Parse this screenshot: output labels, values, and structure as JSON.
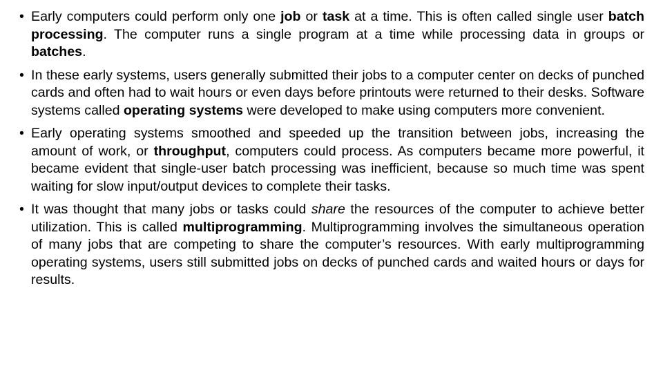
{
  "bullets": [
    {
      "segments": [
        {
          "t": "Early computers could perform only one "
        },
        {
          "t": "job",
          "b": true
        },
        {
          "t": " or "
        },
        {
          "t": "task",
          "b": true
        },
        {
          "t": " at a time. This is often called single user "
        },
        {
          "t": "batch processing",
          "b": true
        },
        {
          "t": ". The computer runs a single program at a time while processing data in groups or "
        },
        {
          "t": "batches",
          "b": true
        },
        {
          "t": "."
        }
      ]
    },
    {
      "segments": [
        {
          "t": "In these early systems, users generally submitted their jobs to a computer center on decks of punched cards and often had to wait hours or even days before printouts were returned to their desks. Software systems called "
        },
        {
          "t": "operating systems",
          "b": true
        },
        {
          "t": " were developed to make using computers more convenient."
        }
      ]
    },
    {
      "segments": [
        {
          "t": "Early operating systems smoothed and speeded up the transition between jobs, increasing the amount of work, or "
        },
        {
          "t": "throughput",
          "b": true
        },
        {
          "t": ", computers could process. As computers became more powerful, it became evident that single-user batch processing was inefficient, because so much time was spent waiting for slow input/output devices to complete their tasks."
        }
      ]
    },
    {
      "segments": [
        {
          "t": "It was thought that many jobs or tasks could "
        },
        {
          "t": "share",
          "i": true
        },
        {
          "t": " the resources of the computer to achieve better utilization. This is called "
        },
        {
          "t": "multiprogramming",
          "b": true
        },
        {
          "t": ". Multiprogramming involves the simultaneous operation of many jobs that are competing to share the computer’s resources. With early multiprogramming operating systems, users still submitted jobs on decks of punched cards and waited hours or days for results."
        }
      ]
    }
  ],
  "bullet_glyph": "•"
}
